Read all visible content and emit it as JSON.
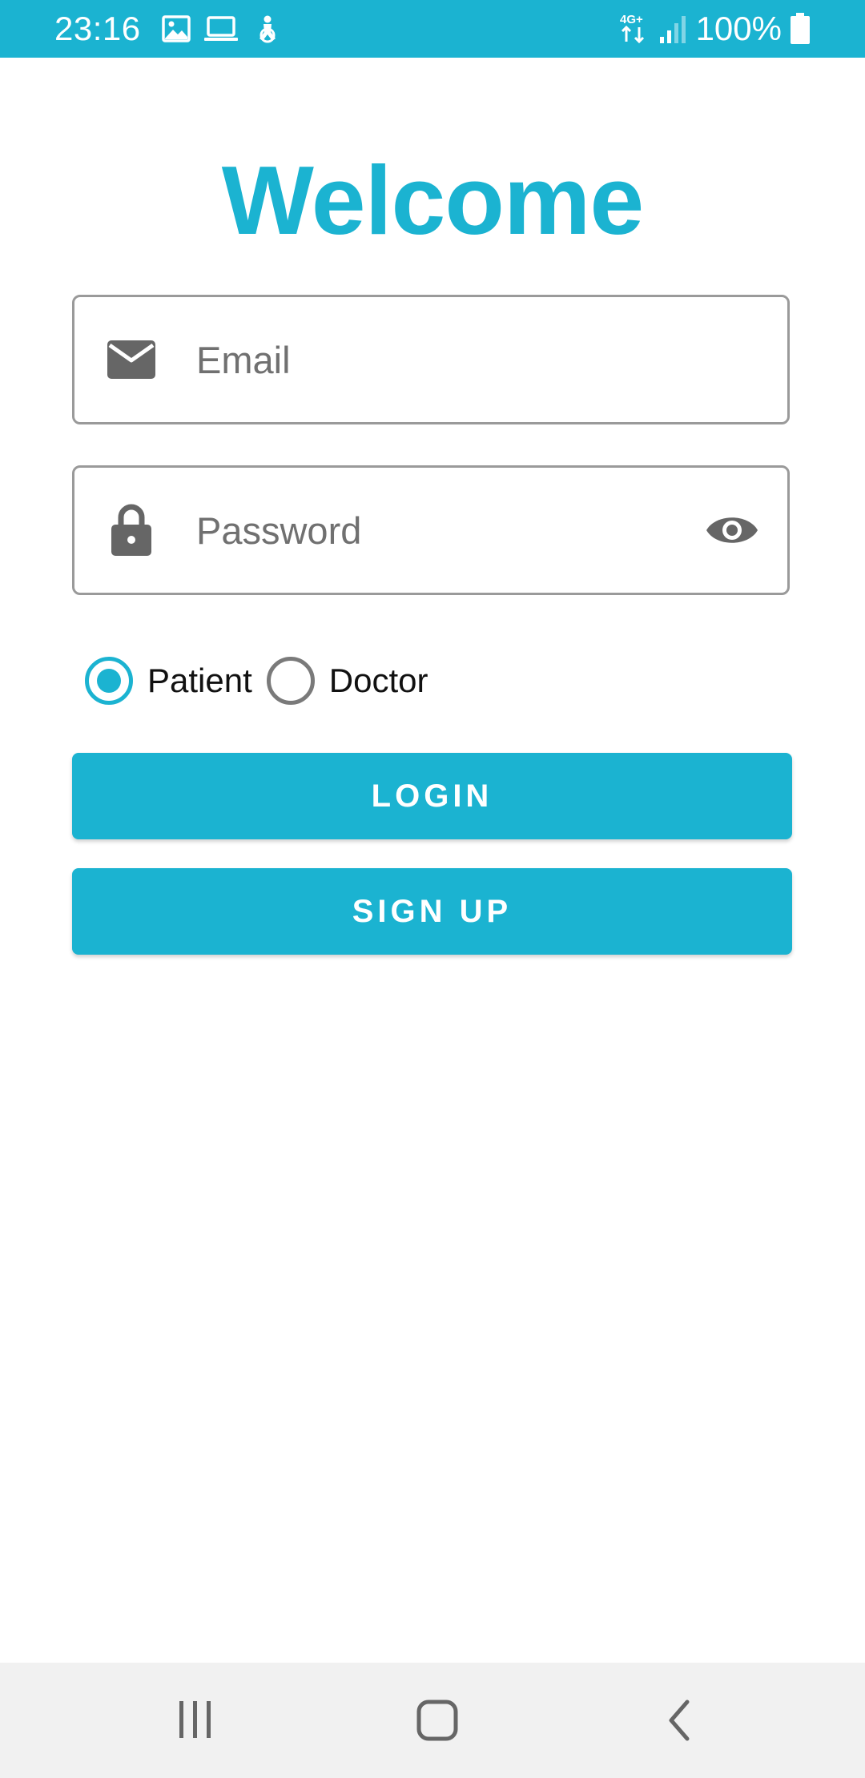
{
  "status_bar": {
    "time": "23:16",
    "network": "4G+",
    "battery": "100%",
    "icons": [
      "image-icon",
      "laptop-icon",
      "accessibility-icon",
      "network-4g-icon",
      "signal-icon",
      "battery-icon"
    ]
  },
  "title": "Welcome",
  "email_field": {
    "placeholder": "Email",
    "value": "",
    "icon": "mail-icon"
  },
  "password_field": {
    "placeholder": "Password",
    "value": "",
    "icon": "lock-icon",
    "toggle_icon": "eye-icon"
  },
  "role": {
    "options": [
      {
        "label": "Patient",
        "selected": true
      },
      {
        "label": "Doctor",
        "selected": false
      }
    ]
  },
  "buttons": {
    "login": "LOGIN",
    "signup": "SIGN UP"
  },
  "nav_bar": {
    "icons": [
      "recents-icon",
      "home-icon",
      "back-icon"
    ]
  },
  "colors": {
    "accent": "#1BB3D1",
    "icon_gray": "#666666",
    "nav_background": "#f1f1f1"
  }
}
